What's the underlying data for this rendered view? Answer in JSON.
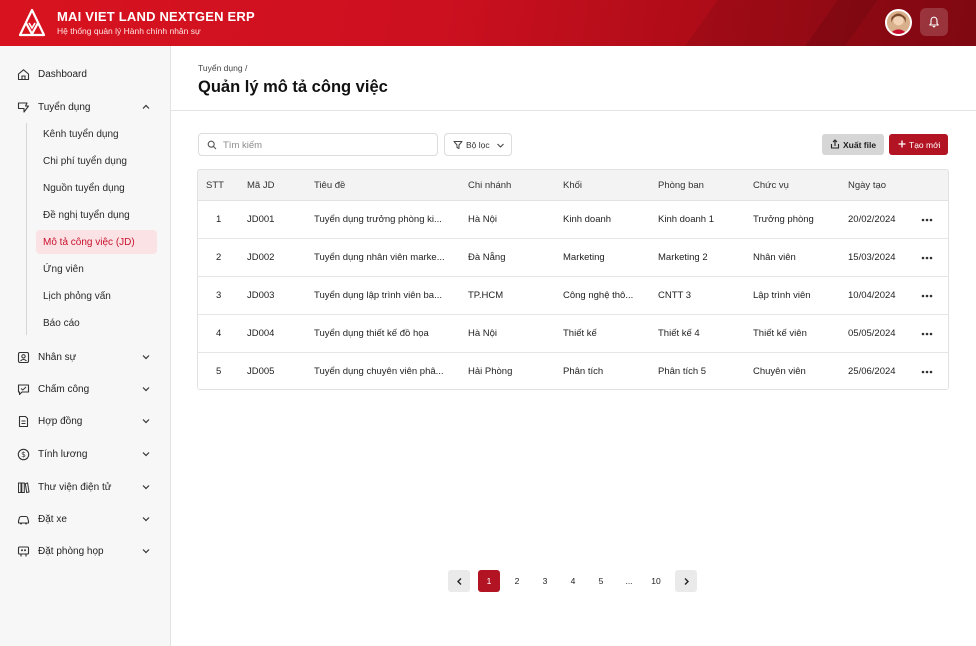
{
  "header": {
    "title": "MAI VIET LAND NEXTGEN ERP",
    "subtitle": "Hệ thống quản lý Hành chính nhân sự"
  },
  "sidebar": {
    "dashboard": "Dashboard",
    "recruitment": "Tuyển dụng",
    "recruitment_sub": [
      "Kênh tuyển dụng",
      "Chi phí tuyển dụng",
      "Nguồn tuyển dụng",
      "Đề nghị tuyển dụng",
      "Mô tả công việc (JD)",
      "Ứng viên",
      "Lịch phỏng vấn",
      "Báo cáo"
    ],
    "active_sub_index": 4,
    "items": [
      "Nhân sự",
      "Chấm công",
      "Hợp đồng",
      "Tính lương",
      "Thư viện điện tử",
      "Đặt xe",
      "Đặt phòng họp"
    ]
  },
  "page": {
    "breadcrumb": "Tuyển dụng /",
    "title": "Quản lý mô tả công việc"
  },
  "toolbar": {
    "search_placeholder": "Tìm kiếm",
    "filter_label": "Bộ lọc",
    "export_label": "Xuất file",
    "create_label": "Tạo mới"
  },
  "table": {
    "columns": [
      "STT",
      "Mã JD",
      "Tiêu đề",
      "Chi nhánh",
      "Khối",
      "Phòng ban",
      "Chức vụ",
      "Ngày tạo"
    ],
    "rows": [
      [
        "1",
        "JD001",
        "Tuyển dụng trưởng phòng ki...",
        "Hà Nội",
        "Kinh doanh",
        "Kinh doanh 1",
        "Trưởng phòng",
        "20/02/2024"
      ],
      [
        "2",
        "JD002",
        "Tuyển dụng nhân viên marke...",
        "Đà Nẵng",
        "Marketing",
        "Marketing 2",
        "Nhân viên",
        "15/03/2024"
      ],
      [
        "3",
        "JD003",
        "Tuyển dụng lập trình viên ba...",
        "TP.HCM",
        "Công nghệ thô...",
        "CNTT 3",
        "Lập trình viên",
        "10/04/2024"
      ],
      [
        "4",
        "JD004",
        "Tuyển dụng thiết kế đồ họa",
        "Hà Nội",
        "Thiết kế",
        "Thiết kế 4",
        "Thiết kế viên",
        "05/05/2024"
      ],
      [
        "5",
        "JD005",
        "Tuyển dụng chuyên viên phâ...",
        "Hải Phòng",
        "Phân tích",
        "Phân tích 5",
        "Chuyên viên",
        "25/06/2024"
      ]
    ]
  },
  "pagination": {
    "pages": [
      "1",
      "2",
      "3",
      "4",
      "5",
      "...",
      "10"
    ],
    "current": "1"
  },
  "colors": {
    "brand_red": "#c8102e",
    "button_red": "#b31424",
    "active_bg": "#fbe3e5"
  }
}
